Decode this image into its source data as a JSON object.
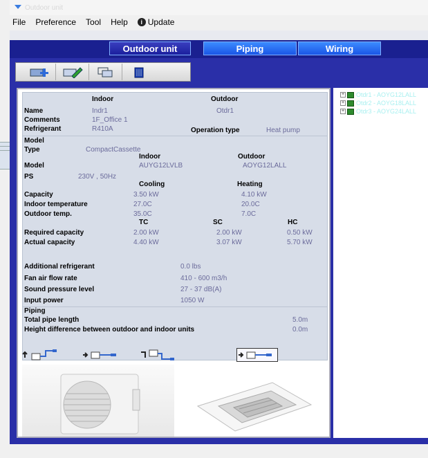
{
  "window": {
    "title": "Outdoor unit"
  },
  "menu": {
    "file": "File",
    "preference": "Preference",
    "tool": "Tool",
    "help": "Help",
    "update": "Update"
  },
  "tabs": {
    "outdoor": "Outdoor unit",
    "piping": "Piping",
    "wiring": "Wiring"
  },
  "info": {
    "head_indoor": "Indoor",
    "head_outdoor": "Outdoor",
    "name_label": "Name",
    "name_indoor": "Indr1",
    "name_outdoor": "Otdr1",
    "comments_label": "Comments",
    "comments_value": "1F_Office 1",
    "refrigerant_label": "Refrigerant",
    "refrigerant_value": "R410A",
    "optype_label": "Operation type",
    "optype_value": "Heat pump",
    "model_section": "Model",
    "type_label": "Type",
    "type_value": "CompactCassette",
    "col_indoor": "Indoor",
    "col_outdoor": "Outdoor",
    "model_label": "Model",
    "model_indoor": "AUYG12LVLB",
    "model_outdoor": "AOYG12LALL",
    "ps_label": "PS",
    "ps_value": "230V , 50Hz",
    "col_cooling": "Cooling",
    "col_heating": "Heating",
    "capacity_label": "Capacity",
    "capacity_cooling": "3.50 kW",
    "capacity_heating": "4.10 kW",
    "indoor_temp_label": "Indoor temperature",
    "indoor_temp_cooling": "27.0C",
    "indoor_temp_heating": "20.0C",
    "outdoor_temp_label": "Outdoor temp.",
    "outdoor_temp_cooling": "35.0C",
    "outdoor_temp_heating": "7.0C",
    "col_tc": "TC",
    "col_sc": "SC",
    "col_hc": "HC",
    "req_cap_label": "Required capacity",
    "req_tc": "2.00 kW",
    "req_sc": "2.00 kW",
    "req_hc": "0.50 kW",
    "act_cap_label": "Actual capacity",
    "act_tc": "4.40 kW",
    "act_sc": "3.07 kW",
    "act_hc": "5.70 kW",
    "add_ref_label": "Additional refrigerant",
    "add_ref_value": "0.0 lbs",
    "fan_label": "Fan air flow rate",
    "fan_value": "410 - 600 m3/h",
    "spl_label": "Sound pressure level",
    "spl_value": "27 - 37 dB(A)",
    "input_label": "Input power",
    "input_value": "1050 W",
    "piping_section": "Piping",
    "pipe_len_label": "Total pipe length",
    "pipe_len_value": "5.0m",
    "height_label": "Height difference between outdoor and indoor units",
    "height_value": "0.0m"
  },
  "tree": {
    "items": [
      "Otdr1 - AOYG12LALL",
      "Otdr2 - AOYG18LALL",
      "Otdr3 - AOYG24LALL"
    ]
  },
  "colors": {
    "accent": "#1a2090",
    "tab_bright": "#1f66ff",
    "info_bg": "#d7dde8",
    "value_text": "#6b6b9b"
  }
}
